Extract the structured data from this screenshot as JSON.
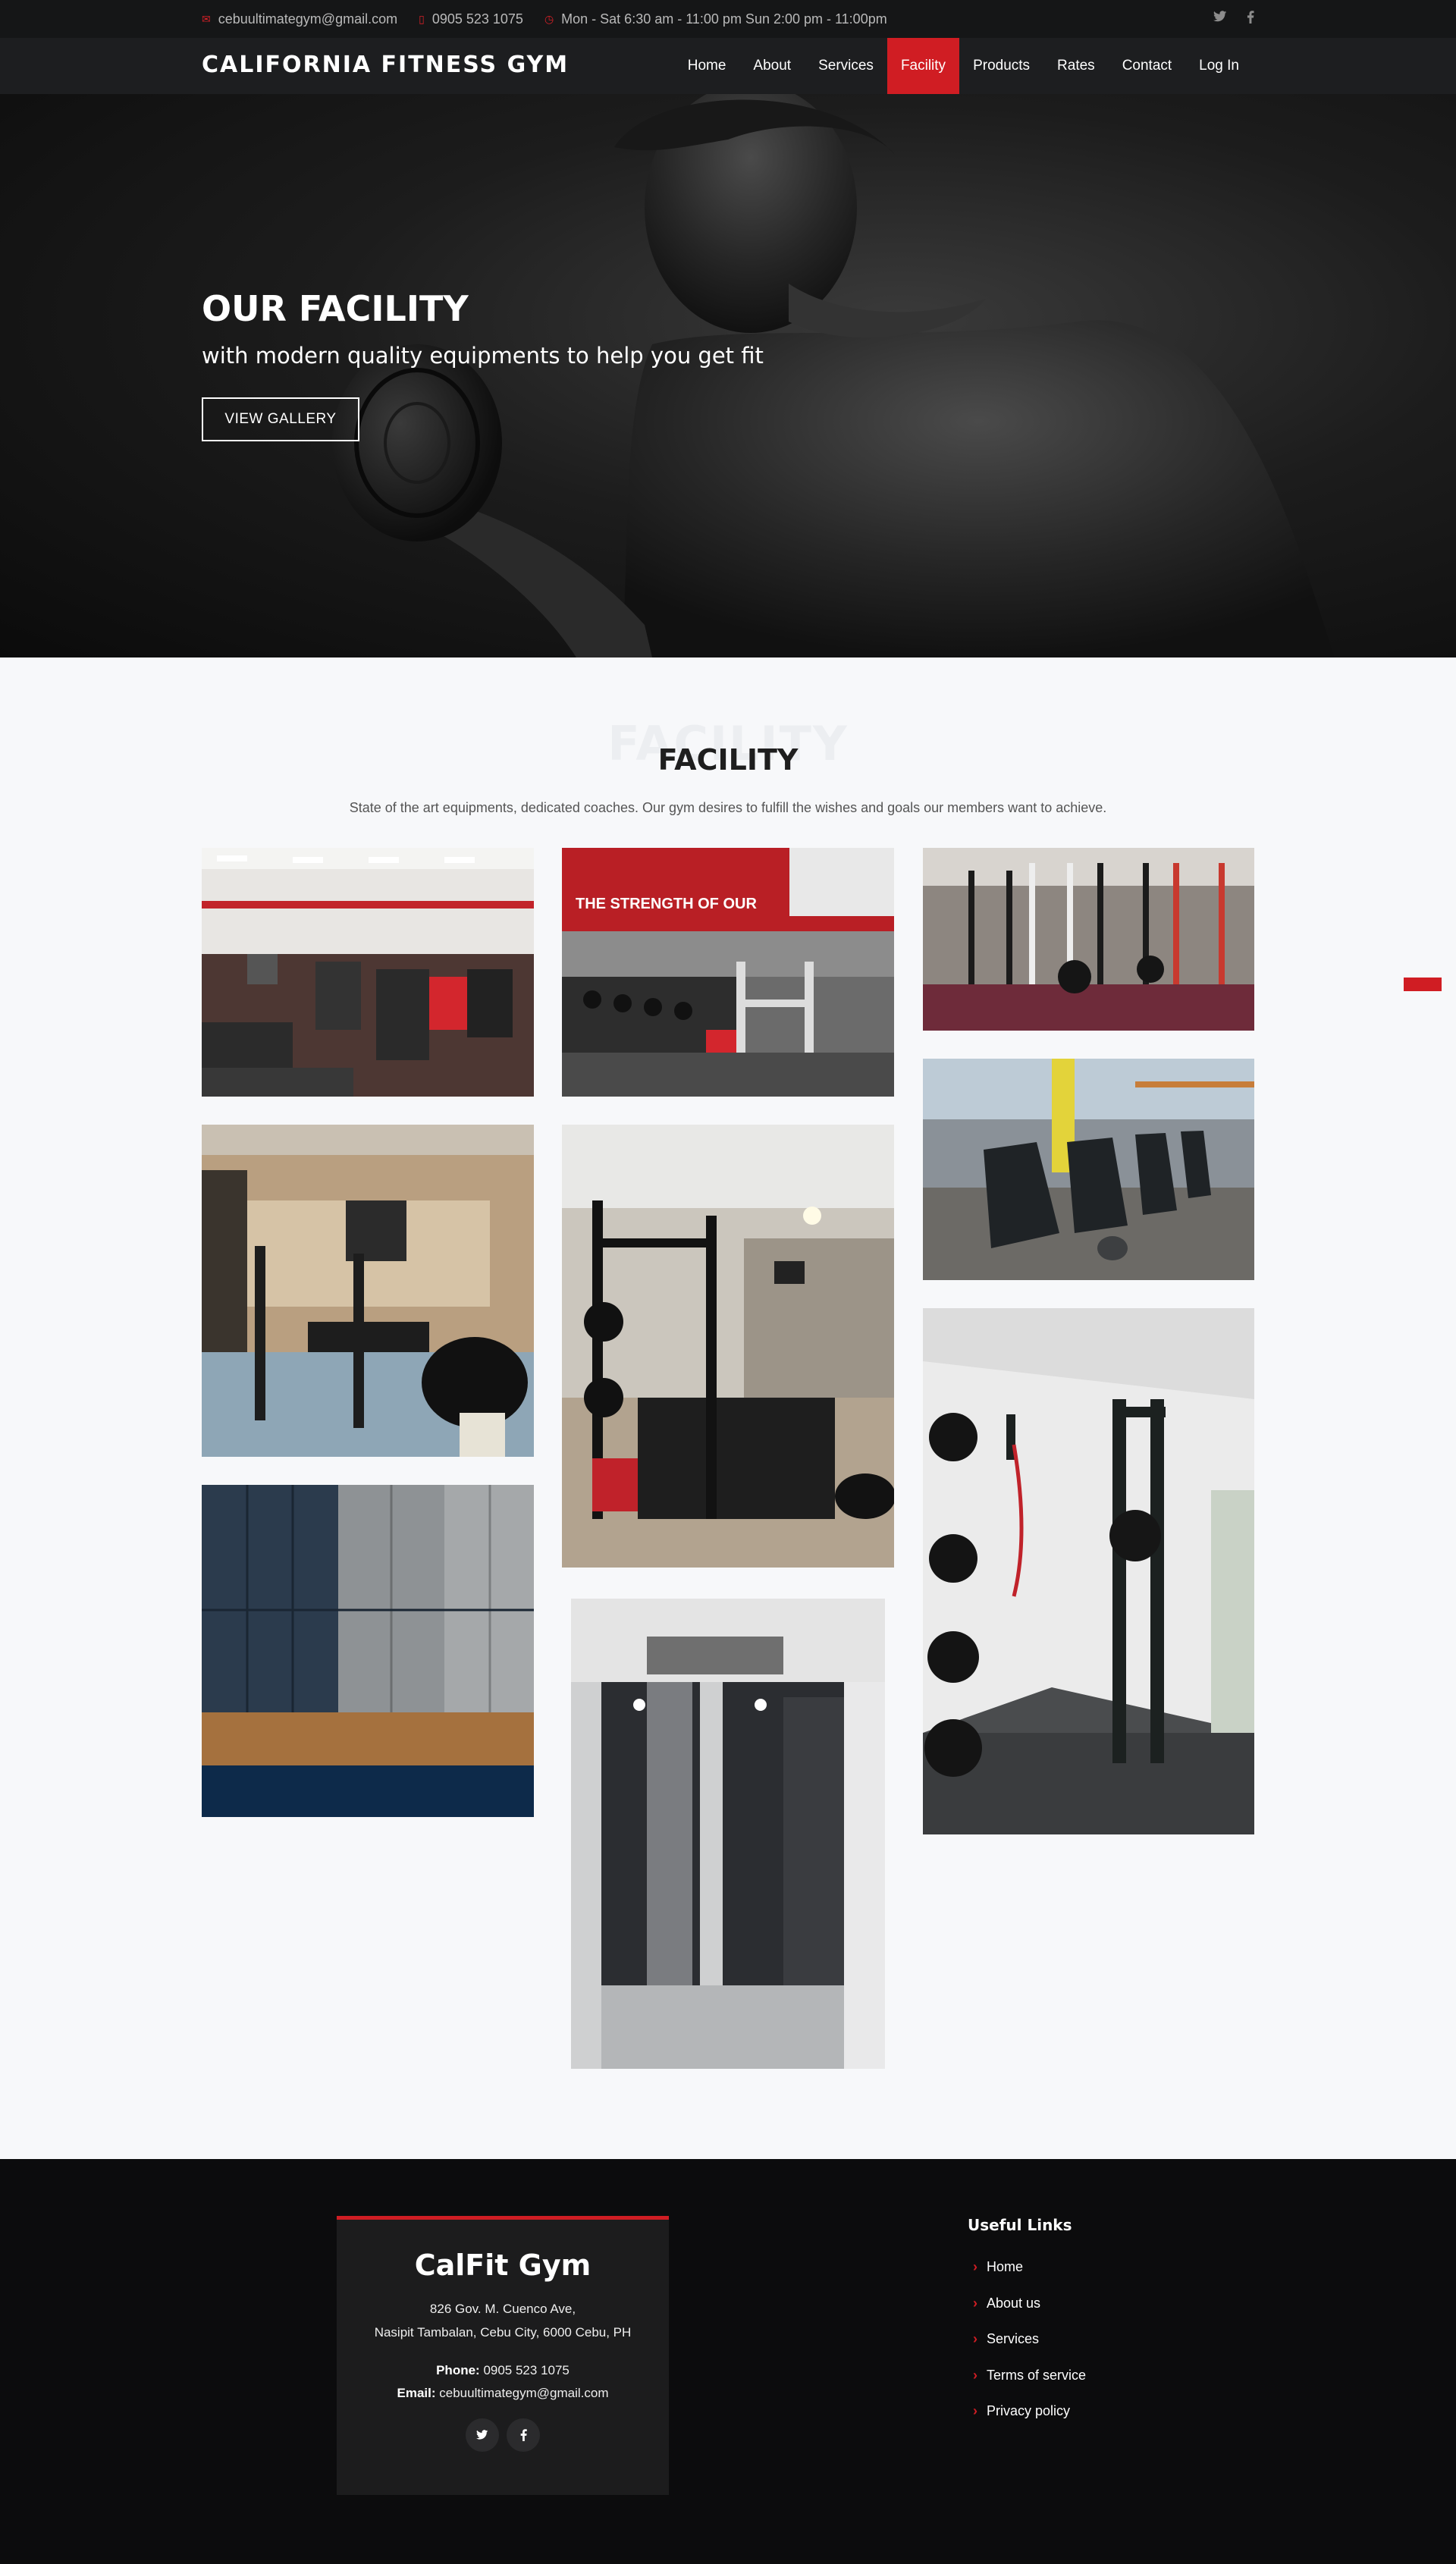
{
  "topbar": {
    "email": "cebuultimategym@gmail.com",
    "phone": "0905 523 1075",
    "hours": "Mon - Sat 6:30 am - 11:00 pm Sun 2:00 pm - 11:00pm",
    "icons": [
      "envelope-icon",
      "phone-icon",
      "clock-icon",
      "twitter-icon",
      "facebook-icon"
    ]
  },
  "header": {
    "logo": "CALIFORNIA FITNESS GYM",
    "nav": [
      "Home",
      "About",
      "Services",
      "Facility",
      "Products",
      "Rates",
      "Contact",
      "Log In"
    ],
    "active": "Facility"
  },
  "hero": {
    "title": "OUR FACILITY",
    "subtitle": "with modern quality equipments to help you get fit",
    "button": "VIEW GALLERY"
  },
  "facility": {
    "bg_title": "FACILITY",
    "title": "FACILITY",
    "description": "State of the art equipments, dedicated coaches. Our gym desires to fulfill the wishes and goals our members want to achieve.",
    "banner_text": "THE STRENGTH OF OUR"
  },
  "footer": {
    "brand": "CalFit Gym",
    "address_line1": "826 Gov. M. Cuenco Ave,",
    "address_line2": "Nasipit Tambalan, Cebu City, 6000 Cebu, PH",
    "phone_label": "Phone:",
    "phone": "0905 523 1075",
    "email_label": "Email:",
    "email": "cebuultimategym@gmail.com",
    "links_title": "Useful Links",
    "links": [
      "Home",
      "About us",
      "Services",
      "Terms of service",
      "Privacy policy"
    ]
  },
  "colors": {
    "accent": "#d01d23",
    "topbar_bg": "#151617",
    "header_bg": "#1d1e20",
    "footer_bg": "#0c0c0d",
    "card_bg": "#1c1c1d",
    "section_bg": "#f7f8fa"
  }
}
